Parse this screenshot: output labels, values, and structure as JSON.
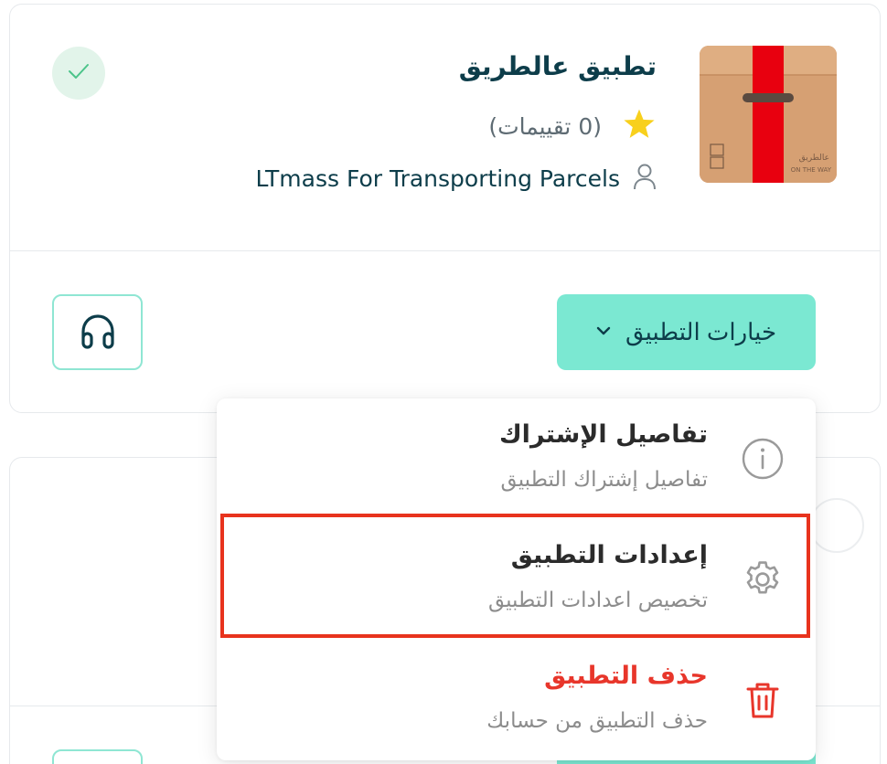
{
  "app": {
    "title": "تطبيق عالطريق",
    "rating_text": "(0 تقييمات)",
    "developer": "LTmass For Transporting Parcels",
    "thumbnail_text_ar": "عالطريق",
    "thumbnail_text_en": "ON THE WAY",
    "thumbnail_colors": {
      "box": "#d8a273",
      "tape": "#e8000f"
    }
  },
  "actions": {
    "options_label": "خيارات التطبيق",
    "options_icon": "chevron-down-icon",
    "support_icon": "headphones-icon",
    "installed_icon": "check-icon"
  },
  "dropdown": {
    "items": [
      {
        "title": "تفاصيل الإشتراك",
        "subtitle": "تفاصيل إشتراك التطبيق",
        "icon": "info-icon"
      },
      {
        "title": "إعدادات التطبيق",
        "subtitle": "تخصيص اعدادات التطبيق",
        "icon": "gear-icon",
        "highlighted": true
      },
      {
        "title": "حذف التطبيق",
        "subtitle": "حذف التطبيق من حسابك",
        "icon": "trash-icon",
        "danger": true
      }
    ]
  },
  "colors": {
    "primary_button": "#7be8d2",
    "outline": "#8fe6d3",
    "danger": "#e8362b",
    "highlight": "#e8331d",
    "heading": "#0d3d4a",
    "star": "#f8d01c"
  }
}
